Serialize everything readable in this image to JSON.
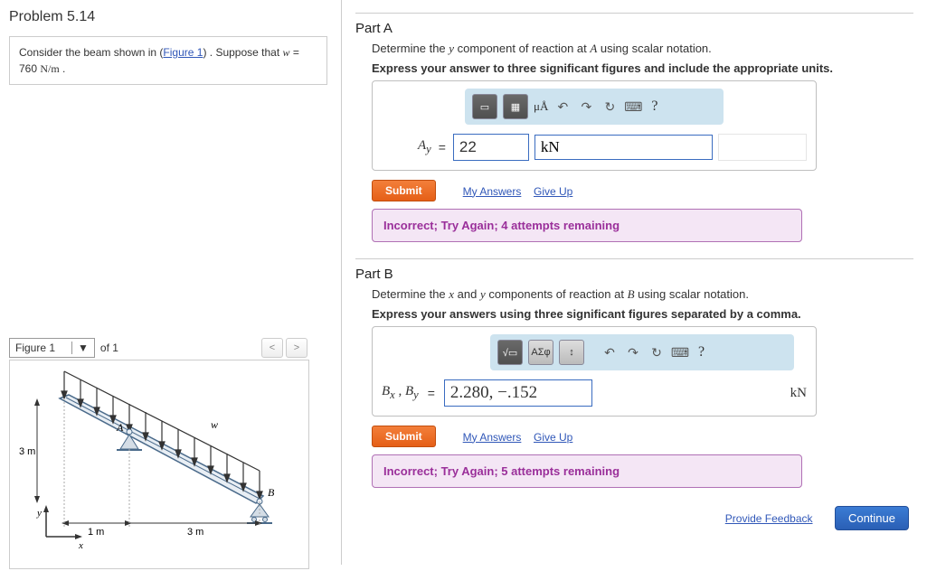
{
  "problem": {
    "title": "Problem 5.14",
    "prompt_pre": "Consider the beam shown in (",
    "figure_link": "Figure 1",
    "prompt_post": ") . Suppose that ",
    "var": "w",
    "equals": " = 760 ",
    "unit": "N/m",
    "period": " ."
  },
  "figure": {
    "label": "Figure 1",
    "of": "of 1",
    "dims": {
      "vertical": "3 m",
      "left_seg": "1 m",
      "right_seg": "3 m"
    },
    "load_label": "w",
    "pointA": "A",
    "pointB": "B",
    "axis_x": "x",
    "axis_y": "y"
  },
  "partA": {
    "title": "Part A",
    "desc_pre": "Determine the ",
    "desc_var": "y",
    "desc_mid": " component of reaction at ",
    "desc_at": "A",
    "desc_post": " using scalar notation.",
    "instr": "Express your answer to three significant figures and include the appropriate units.",
    "toolbar_label": "μÅ",
    "ans_label": "A",
    "ans_sub": "y",
    "value": "22",
    "unit": "kN",
    "submit": "Submit",
    "my_answers": "My Answers",
    "give_up": "Give Up",
    "feedback": "Incorrect; Try Again; 4 attempts remaining"
  },
  "partB": {
    "title": "Part B",
    "desc_pre": "Determine the ",
    "desc_x": "x",
    "desc_and": " and ",
    "desc_y": "y",
    "desc_mid": " components of reaction at ",
    "desc_at": "B",
    "desc_post": " using scalar notation.",
    "instr": "Express your answers using three significant figures separated by a comma.",
    "toolbar_label": "ΑΣφ",
    "ans_label_pre": "B",
    "ans_label_x": "x",
    "comma": " , ",
    "ans_label_y": "y",
    "value": "2.280, −.152",
    "unit": "kN",
    "submit": "Submit",
    "my_answers": "My Answers",
    "give_up": "Give Up",
    "feedback": "Incorrect; Try Again; 5 attempts remaining"
  },
  "footer": {
    "provide_feedback": "Provide Feedback",
    "continue": "Continue"
  }
}
